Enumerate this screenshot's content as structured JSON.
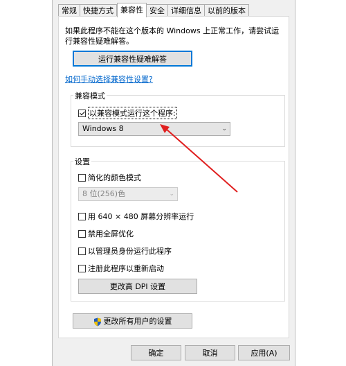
{
  "tabs": [
    {
      "label": "常规"
    },
    {
      "label": "快捷方式"
    },
    {
      "label": "兼容性"
    },
    {
      "label": "安全"
    },
    {
      "label": "详细信息"
    },
    {
      "label": "以前的版本"
    }
  ],
  "intro_text": "如果此程序不能在这个版本的 Windows 上正常工作，请尝试运行兼容性疑难解答。",
  "troubleshooter_button": "运行兼容性疑难解答",
  "manual_link": "如何手动选择兼容性设置?",
  "compat_mode": {
    "group_title": "兼容模式",
    "checkbox_label": "以兼容模式运行这个程序:",
    "checked": true,
    "selected_os": "Windows 8"
  },
  "settings": {
    "group_title": "设置",
    "reduced_color_label": "简化的颜色模式",
    "color_depth_value": "8 位(256)色",
    "resolution_label": "用 640 × 480 屏幕分辨率运行",
    "disable_fullscreen_label": "禁用全屏优化",
    "run_as_admin_label": "以管理员身份运行此程序",
    "register_restart_label": "注册此程序以重新启动",
    "dpi_button": "更改高 DPI 设置"
  },
  "all_users_button": "更改所有用户的设置",
  "footer": {
    "ok": "确定",
    "cancel": "取消",
    "apply": "应用(A)"
  },
  "colors": {
    "annotation_arrow": "#e02020",
    "focus_blue": "#0078d7",
    "link": "#0066cc"
  }
}
